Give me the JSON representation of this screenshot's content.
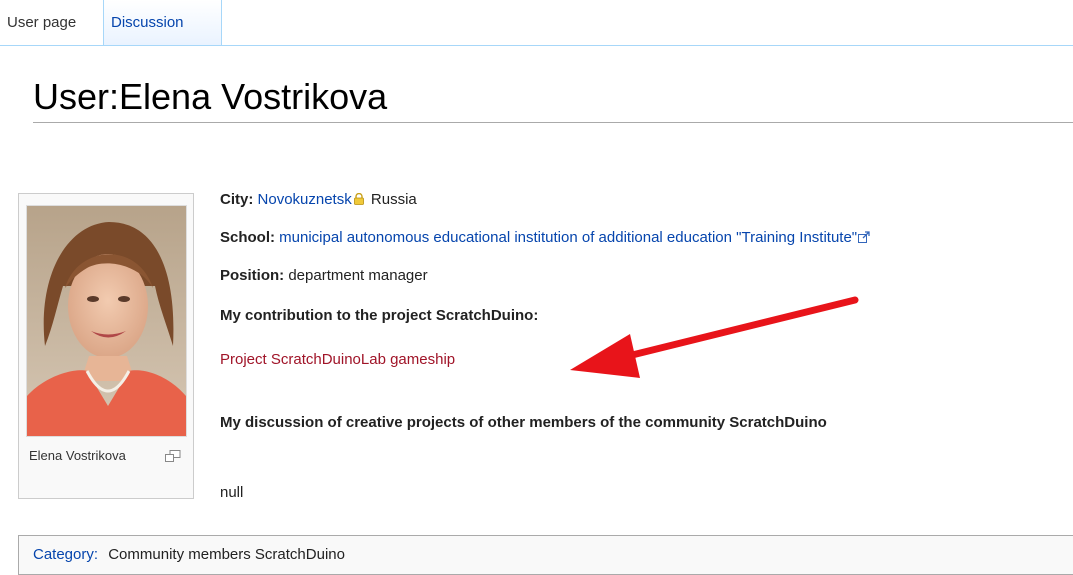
{
  "tabs": {
    "user_page": "User page",
    "discussion": "Discussion"
  },
  "page_title": "User:Elena Vostrikova",
  "thumb": {
    "caption": "Elena Vostrikova"
  },
  "info": {
    "city_label": "City:",
    "city_value": "Novokuznetsk",
    "country": "Russia",
    "school_label": "School:",
    "school_value": "municipal autonomous educational institution of additional education \"Training Institute\"",
    "position_label": "Position:",
    "position_value": "department manager",
    "contribution_heading": "My contribution to the project ScratchDuino:",
    "project_link": "Project ScratchDuinoLab gameship",
    "discussion_heading": "My discussion of creative projects of other members of the community ScratchDuino",
    "null_text": "null"
  },
  "category": {
    "label": "Category:",
    "value": "Community members ScratchDuino"
  },
  "colors": {
    "link": "#0645ad",
    "red_link": "#a01428",
    "arrow": "#e8141a",
    "tab_border": "#a7d7f9"
  }
}
